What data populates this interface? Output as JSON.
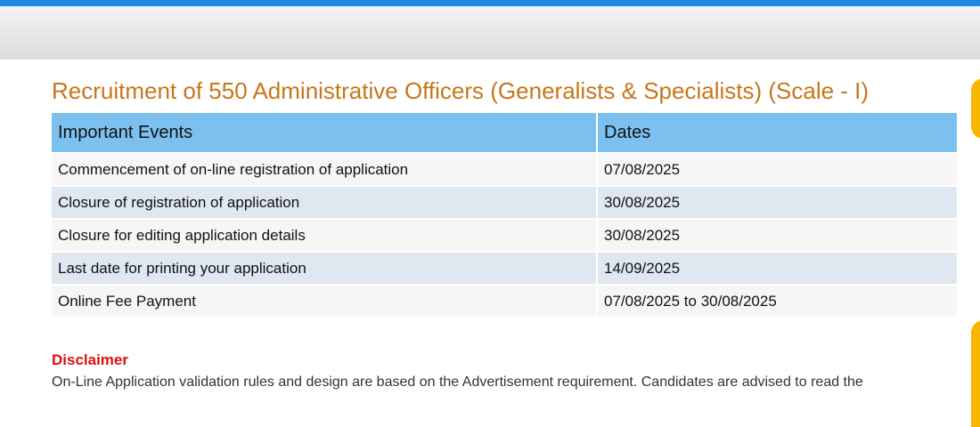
{
  "page": {
    "title": "Recruitment of 550 Administrative Officers (Generalists & Specialists) (Scale - I)"
  },
  "events_table": {
    "headers": [
      "Important Events",
      "Dates"
    ],
    "rows": [
      {
        "event": "Commencement of on-line registration of application",
        "date": "07/08/2025"
      },
      {
        "event": "Closure of registration of application",
        "date": "30/08/2025"
      },
      {
        "event": "Closure for editing application details",
        "date": "30/08/2025"
      },
      {
        "event": "Last date for printing your application",
        "date": "14/09/2025"
      },
      {
        "event": "Online Fee Payment",
        "date": "07/08/2025 to 30/08/2025"
      }
    ]
  },
  "disclaimer": {
    "title": "Disclaimer",
    "text": "On-Line Application validation rules and design are based on the Advertisement requirement. Candidates are advised to read the"
  },
  "colors": {
    "top_bar": "#1e88e5",
    "title": "#c8761a",
    "table_header": "#7cc0f0",
    "disclaimer_title": "#dd1111",
    "side_tab": "#f7b500"
  }
}
